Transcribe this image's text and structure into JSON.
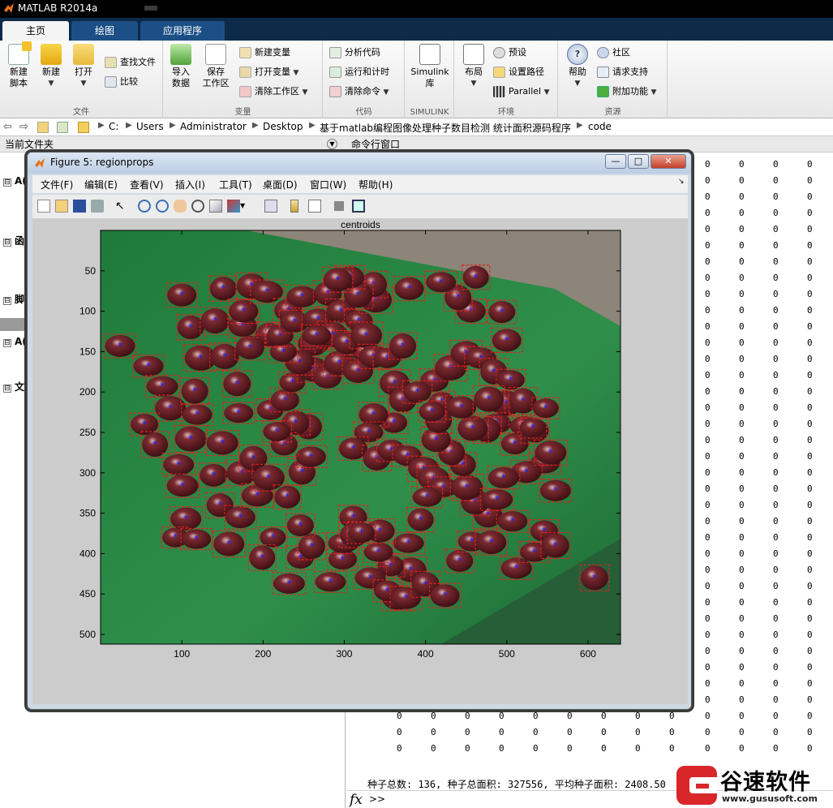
{
  "app": {
    "title": "MATLAB R2014a"
  },
  "tabs": [
    "主页",
    "绘图",
    "应用程序"
  ],
  "ribbon": {
    "file": {
      "label": "文件",
      "new_script": [
        "新建",
        "脚本"
      ],
      "new": "新建",
      "open": "打开",
      "find_files": "查找文件",
      "compare": "比较"
    },
    "variable": {
      "label": "变量",
      "import": [
        "导入",
        "数据"
      ],
      "save": [
        "保存",
        "工作区"
      ],
      "new_var": "新建变量",
      "open_var": "打开变量",
      "clear_ws": "清除工作区"
    },
    "code": {
      "label": "代码",
      "analyze": "分析代码",
      "run_time": "运行和计时",
      "clear_cmd": "清除命令"
    },
    "simulink": {
      "label": "SIMULINK",
      "lib": [
        "Simulink",
        "库"
      ]
    },
    "env": {
      "label": "环境",
      "layout": "布局",
      "prefs": "预设",
      "set_path": "设置路径",
      "parallel": "Parallel"
    },
    "resources": {
      "label": "资源",
      "help": "帮助",
      "community": "社区",
      "support": "请求支持",
      "addons": "附加功能"
    }
  },
  "address": {
    "crumbs": [
      "C:",
      "Users",
      "Administrator",
      "Desktop",
      "基于matlab编程图像处理种子数目检测 统计面积源码程序",
      "code"
    ]
  },
  "left_panel": {
    "title": "当前文件夹",
    "rows": [
      {
        "box": "⊟",
        "text": "A("
      },
      {
        "box": "⊟",
        "text": "函"
      },
      {
        "box": "⊟",
        "text": "脚"
      },
      {
        "box": "⊟",
        "text": "A("
      },
      {
        "box": "⊟",
        "text": "文"
      }
    ]
  },
  "command_window": {
    "title": "命令行窗口",
    "zero": "0",
    "summary": "种子总数: 136, 种子总面积: 327556, 平均种子面积: 2408.50",
    "prompt": ">>",
    "fx": "fx"
  },
  "figure": {
    "title": "Figure 5: regionprops",
    "menus": [
      "文件(F)",
      "编辑(E)",
      "查看(V)",
      "插入(I)",
      "工具(T)",
      "桌面(D)",
      "窗口(W)",
      "帮助(H)"
    ],
    "win_buttons": [
      "—",
      "□",
      "✕"
    ]
  },
  "chart_data": {
    "type": "scatter",
    "title": "centroids",
    "xlim": [
      0,
      640
    ],
    "ylim": [
      0,
      512
    ],
    "y_reversed": true,
    "x_ticks": [
      100,
      200,
      300,
      400,
      500,
      600
    ],
    "y_ticks": [
      50,
      100,
      150,
      200,
      250,
      300,
      350,
      400,
      450,
      500
    ],
    "centroids": [
      [
        24,
        143
      ],
      [
        59,
        168
      ],
      [
        76,
        193
      ],
      [
        86,
        220
      ],
      [
        54,
        240
      ],
      [
        67,
        265
      ],
      [
        96,
        290
      ],
      [
        101,
        316
      ],
      [
        105,
        357
      ],
      [
        92,
        380
      ],
      [
        118,
        382
      ],
      [
        111,
        258
      ],
      [
        119,
        228
      ],
      [
        116,
        199
      ],
      [
        123,
        158
      ],
      [
        111,
        120
      ],
      [
        100,
        80
      ],
      [
        151,
        72
      ],
      [
        141,
        112
      ],
      [
        153,
        156
      ],
      [
        168,
        190
      ],
      [
        170,
        226
      ],
      [
        150,
        263
      ],
      [
        139,
        303
      ],
      [
        147,
        340
      ],
      [
        158,
        388
      ],
      [
        172,
        355
      ],
      [
        174,
        300
      ],
      [
        188,
        282
      ],
      [
        193,
        328
      ],
      [
        207,
        306
      ],
      [
        212,
        380
      ],
      [
        199,
        405
      ],
      [
        232,
        437
      ],
      [
        246,
        405
      ],
      [
        260,
        391
      ],
      [
        246,
        365
      ],
      [
        230,
        330
      ],
      [
        248,
        299
      ],
      [
        259,
        280
      ],
      [
        256,
        243
      ],
      [
        240,
        238
      ],
      [
        226,
        265
      ],
      [
        217,
        249
      ],
      [
        209,
        222
      ],
      [
        227,
        210
      ],
      [
        236,
        188
      ],
      [
        262,
        172
      ],
      [
        262,
        140
      ],
      [
        245,
        163
      ],
      [
        225,
        150
      ],
      [
        208,
        129
      ],
      [
        184,
        145
      ],
      [
        175,
        118
      ],
      [
        176,
        100
      ],
      [
        186,
        69
      ],
      [
        205,
        76
      ],
      [
        231,
        99
      ],
      [
        221,
        130
      ],
      [
        239,
        113
      ],
      [
        248,
        82
      ],
      [
        280,
        78
      ],
      [
        268,
        110
      ],
      [
        296,
        100
      ],
      [
        286,
        129
      ],
      [
        279,
        182
      ],
      [
        294,
        164
      ],
      [
        317,
        174
      ],
      [
        326,
        150
      ],
      [
        303,
        139
      ],
      [
        318,
        112
      ],
      [
        339,
        86
      ],
      [
        336,
        67
      ],
      [
        317,
        80
      ],
      [
        307,
        58
      ],
      [
        292,
        61
      ],
      [
        266,
        130
      ],
      [
        327,
        130
      ],
      [
        336,
        156
      ],
      [
        353,
        158
      ],
      [
        372,
        143
      ],
      [
        362,
        189
      ],
      [
        372,
        210
      ],
      [
        361,
        238
      ],
      [
        336,
        228
      ],
      [
        330,
        250
      ],
      [
        311,
        270
      ],
      [
        340,
        282
      ],
      [
        358,
        272
      ],
      [
        378,
        279
      ],
      [
        398,
        295
      ],
      [
        410,
        307
      ],
      [
        422,
        318
      ],
      [
        402,
        330
      ],
      [
        394,
        358
      ],
      [
        379,
        387
      ],
      [
        382,
        420
      ],
      [
        366,
        455
      ],
      [
        357,
        415
      ],
      [
        342,
        398
      ],
      [
        344,
        372
      ],
      [
        311,
        355
      ],
      [
        298,
        407
      ],
      [
        283,
        435
      ],
      [
        299,
        387
      ],
      [
        312,
        377
      ],
      [
        321,
        374
      ],
      [
        332,
        430
      ],
      [
        353,
        446
      ],
      [
        376,
        455
      ],
      [
        400,
        438
      ],
      [
        424,
        452
      ],
      [
        442,
        409
      ],
      [
        457,
        385
      ],
      [
        481,
        386
      ],
      [
        477,
        352
      ],
      [
        461,
        336
      ],
      [
        451,
        318
      ],
      [
        446,
        290
      ],
      [
        432,
        275
      ],
      [
        413,
        259
      ],
      [
        416,
        235
      ],
      [
        420,
        212
      ],
      [
        411,
        186
      ],
      [
        431,
        170
      ],
      [
        450,
        152
      ],
      [
        468,
        158
      ],
      [
        484,
        175
      ],
      [
        505,
        185
      ],
      [
        499,
        214
      ],
      [
        487,
        239
      ],
      [
        476,
        247
      ],
      [
        458,
        245
      ],
      [
        444,
        219
      ],
      [
        478,
        209
      ],
      [
        500,
        136
      ],
      [
        494,
        101
      ],
      [
        456,
        100
      ],
      [
        440,
        83
      ],
      [
        419,
        64
      ],
      [
        462,
        58
      ],
      [
        380,
        72
      ],
      [
        390,
        200
      ],
      [
        408,
        224
      ],
      [
        522,
        242
      ],
      [
        510,
        264
      ],
      [
        535,
        248
      ],
      [
        547,
        288
      ],
      [
        524,
        299
      ],
      [
        496,
        306
      ],
      [
        488,
        333
      ],
      [
        507,
        360
      ],
      [
        512,
        418
      ],
      [
        534,
        398
      ],
      [
        546,
        372
      ],
      [
        560,
        322
      ],
      [
        554,
        275
      ],
      [
        532,
        244
      ],
      [
        520,
        211
      ],
      [
        548,
        220
      ],
      [
        560,
        390
      ],
      [
        608,
        430
      ]
    ]
  }
}
